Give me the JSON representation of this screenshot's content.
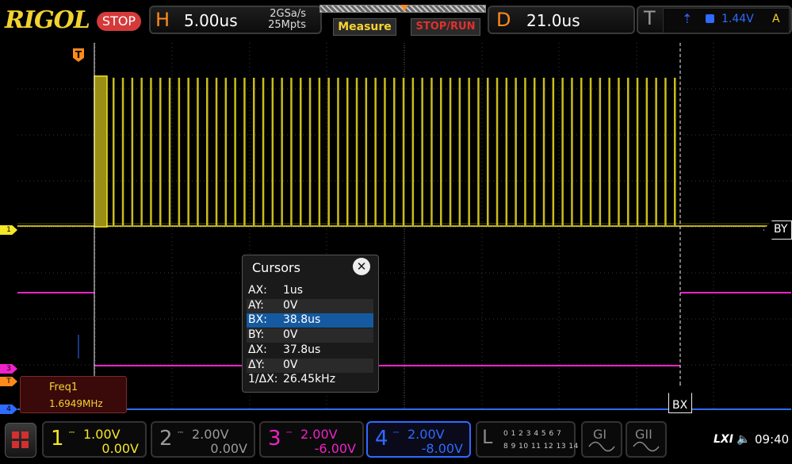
{
  "brand": {
    "logo": "RIGOL",
    "status": "STOP"
  },
  "horizontal": {
    "letter": "H",
    "timebase": "5.00us",
    "sample_rate": "2GSa/s",
    "memory_depth": "25Mpts"
  },
  "toolbar": {
    "measure_label": "Measure",
    "stoprun_label": "STOP/RUN"
  },
  "delay": {
    "letter": "D",
    "value": "21.0us"
  },
  "trigger": {
    "letter": "T",
    "edge_symbol": "⇡",
    "level": "1.44V",
    "mode": "A",
    "source_color": "#2e6bff"
  },
  "cursors": {
    "title": "Cursors",
    "close_label": "✕",
    "rows": [
      {
        "key": "AX:",
        "value": "1us"
      },
      {
        "key": "AY:",
        "value": "0V"
      },
      {
        "key": "BX:",
        "value": "38.8us"
      },
      {
        "key": "BY:",
        "value": "0V"
      },
      {
        "key": "ΔX:",
        "value": "37.8us"
      },
      {
        "key": "ΔY:",
        "value": "0V"
      },
      {
        "key": "1/ΔX:",
        "value": "26.45kHz"
      }
    ],
    "selected_index": 2
  },
  "cursor_labels": {
    "by": "BY",
    "bx": "BX"
  },
  "measurement": {
    "name": "Freq1",
    "value": "1.6949MHz"
  },
  "edge_markers": {
    "ch1": "1",
    "ch3": "3",
    "trig": "T",
    "ch4": "4"
  },
  "channels": [
    {
      "num": "1",
      "scale": "1.00V",
      "offset": "0.00V",
      "color": "#f5e626"
    },
    {
      "num": "2",
      "scale": "2.00V",
      "offset": "0.00V",
      "color": "#9a9a9a"
    },
    {
      "num": "3",
      "scale": "2.00V",
      "offset": "-6.00V",
      "color": "#ee22c8"
    },
    {
      "num": "4",
      "scale": "2.00V",
      "offset": "-8.00V",
      "color": "#2e6bff"
    }
  ],
  "logic": {
    "letter": "L",
    "row1": "0 1 2 3   4 5 6 7",
    "row2": "8 9 10 11 12 13 14 15"
  },
  "generators": [
    {
      "label": "GI"
    },
    {
      "label": "GII"
    }
  ],
  "status_bar": {
    "lxi": "LXI",
    "speaker": "🔈",
    "time": "09:40"
  }
}
